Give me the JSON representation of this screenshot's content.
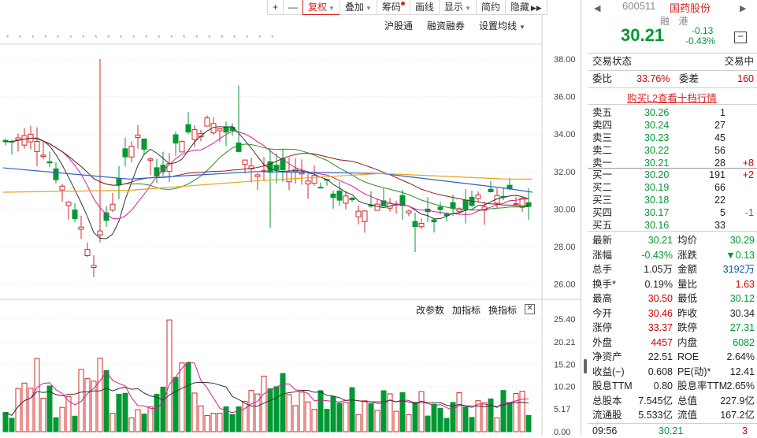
{
  "toolbar": {
    "plus": "+",
    "minus": "—",
    "fuquan": "复权",
    "diejia": "叠加",
    "chouma": "筹码",
    "huaxian": "画线",
    "xianshi": "显示",
    "jianyue": "简约",
    "yincang": "隐藏"
  },
  "subbar": {
    "hgt": "沪股通",
    "rzrq": "融资融券",
    "ma": "设置均线"
  },
  "indicator_bar": {
    "params": "改参数",
    "add": "加指标",
    "swap": "换指标",
    "close": "✕"
  },
  "price_axis": [
    "38.00",
    "36.00",
    "34.00",
    "32.00",
    "30.00",
    "28.00",
    "26.00"
  ],
  "volume_axis": [
    "25.40",
    "20.21",
    "15.20",
    "10.20",
    "5.17",
    "0.00"
  ],
  "colors": {
    "up": "#d62727",
    "down": "#009933",
    "ma5": "#333333",
    "ma10": "#d81b9c",
    "ma20": "#2e8b2e",
    "ma30": "#8b1a1a",
    "ma60": "#2a60c8",
    "ma120": "#e8a21b"
  },
  "quote": {
    "code": "600511",
    "name": "国药股份",
    "badges": "融 港",
    "price": "30.21",
    "change": "-0.13",
    "change_pct": "-0.43%",
    "status_label": "交易状态",
    "status_value": "交易中",
    "weibi_label": "委比",
    "weibi_value": "33.76%",
    "weicha_label": "委差",
    "weicha_value": "160",
    "l2_link": "购买L2查看十档行情"
  },
  "asks": [
    {
      "label": "卖五",
      "price": "30.26",
      "vol": "1",
      "chg": ""
    },
    {
      "label": "卖四",
      "price": "30.24",
      "vol": "27",
      "chg": ""
    },
    {
      "label": "卖三",
      "price": "30.23",
      "vol": "45",
      "chg": ""
    },
    {
      "label": "卖二",
      "price": "30.22",
      "vol": "56",
      "chg": ""
    },
    {
      "label": "卖一",
      "price": "30.21",
      "vol": "28",
      "chg": "+8"
    }
  ],
  "bids": [
    {
      "label": "买一",
      "price": "30.20",
      "vol": "191",
      "chg": "+2"
    },
    {
      "label": "买二",
      "price": "30.19",
      "vol": "66",
      "chg": ""
    },
    {
      "label": "买三",
      "price": "30.18",
      "vol": "22",
      "chg": ""
    },
    {
      "label": "买四",
      "price": "30.17",
      "vol": "5",
      "chg": "-1"
    },
    {
      "label": "买五",
      "price": "30.16",
      "vol": "33",
      "chg": ""
    }
  ],
  "stats": [
    {
      "l1": "最新",
      "v1": "30.21",
      "c1": "green",
      "l2": "均价",
      "v2": "30.29",
      "c2": "green"
    },
    {
      "l1": "涨幅",
      "v1": "-0.43%",
      "c1": "green",
      "l2": "涨跌",
      "v2": "▼0.13",
      "c2": "green"
    },
    {
      "l1": "总手",
      "v1": "1.05万",
      "c1": "dark",
      "l2": "金额",
      "v2": "3192万",
      "c2": "blue"
    },
    {
      "l1": "换手*",
      "v1": "0.19%",
      "c1": "dark",
      "l2": "量比",
      "v2": "1.63",
      "c2": "red"
    },
    {
      "l1": "最高",
      "v1": "30.50",
      "c1": "red",
      "l2": "最低",
      "v2": "30.12",
      "c2": "green"
    },
    {
      "l1": "今开",
      "v1": "30.46",
      "c1": "red",
      "l2": "昨收",
      "v2": "30.34",
      "c2": "dark"
    },
    {
      "l1": "涨停",
      "v1": "33.37",
      "c1": "red",
      "l2": "跌停",
      "v2": "27.31",
      "c2": "green"
    },
    {
      "l1": "外盘",
      "v1": "4457",
      "c1": "red",
      "l2": "内盘",
      "v2": "6082",
      "c2": "green"
    },
    {
      "l1": "净资产",
      "v1": "22.51",
      "c1": "dark",
      "l2": "ROE",
      "v2": "2.64%",
      "c2": "dark"
    },
    {
      "l1": "收益(−)",
      "v1": "0.608",
      "c1": "dark",
      "l2": "PE(动)*",
      "v2": "12.41",
      "c2": "dark"
    },
    {
      "l1": "股息TTM",
      "v1": "0.80",
      "c1": "dark",
      "l2": "股息率TTM",
      "v2": "2.65%",
      "c2": "dark"
    },
    {
      "l1": "总股本",
      "v1": "7.545亿",
      "c1": "dark",
      "l2": "总值",
      "v2": "227.9亿",
      "c2": "dark"
    },
    {
      "l1": "流通股",
      "v1": "5.533亿",
      "c1": "dark",
      "l2": "流值",
      "v2": "167.2亿",
      "c2": "dark"
    }
  ],
  "tick": {
    "time": "09:56",
    "price": "30.21",
    "vol": "3"
  }
}
